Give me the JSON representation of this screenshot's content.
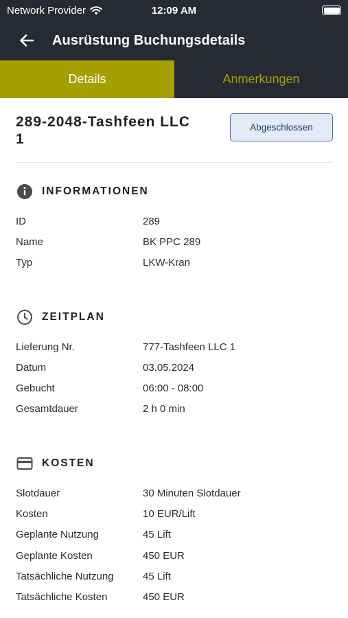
{
  "status_bar": {
    "carrier": "Network Provider",
    "time": "12:09 AM"
  },
  "app_bar": {
    "title": "Ausrüstung Buchungsdetails"
  },
  "tabs": [
    {
      "label": "Details",
      "active": true
    },
    {
      "label": "Anmerkungen",
      "active": false
    }
  ],
  "booking": {
    "title": "289-2048-Tashfeen LLC 1",
    "status_label": "Abgeschlossen"
  },
  "sections": {
    "informationen": {
      "title": "INFORMATIONEN",
      "icon": "info-icon",
      "rows": [
        {
          "label": "ID",
          "value": "289"
        },
        {
          "label": "Name",
          "value": "BK PPC 289"
        },
        {
          "label": "Typ",
          "value": "LKW-Kran"
        }
      ]
    },
    "zeitplan": {
      "title": "ZEITPLAN",
      "icon": "clock-icon",
      "rows": [
        {
          "label": "Lieferung Nr.",
          "value": "777-Tashfeen LLC 1"
        },
        {
          "label": "Datum",
          "value": "03.05.2024"
        },
        {
          "label": "Gebucht",
          "value": "06:00 - 08:00"
        },
        {
          "label": "Gesamtdauer",
          "value": "2 h 0 min"
        }
      ]
    },
    "kosten": {
      "title": "KOSTEN",
      "icon": "credit-card-icon",
      "rows": [
        {
          "label": "Slotdauer",
          "value": "30 Minuten Slotdauer"
        },
        {
          "label": "Kosten",
          "value": "10 EUR/Lift"
        },
        {
          "label": "Geplante Nutzung",
          "value": "45 Lift"
        },
        {
          "label": "Geplante Kosten",
          "value": "450 EUR"
        },
        {
          "label": "Tatsächliche Nutzung",
          "value": "45 Lift"
        },
        {
          "label": "Tatsächliche Kosten",
          "value": "450 EUR"
        }
      ]
    }
  },
  "colors": {
    "header_bg": "#272a33",
    "accent": "#a3a000",
    "status_button_bg": "#e2ebf6",
    "status_button_border": "#4f6fa0"
  }
}
